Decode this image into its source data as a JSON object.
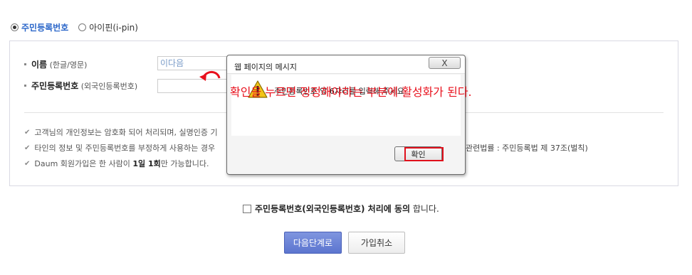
{
  "auth_options": {
    "resident_label": "주민등록번호",
    "ipin_label": "아이핀(i-pin)"
  },
  "form": {
    "name_label": "이름",
    "name_sub": "(한글/영문)",
    "name_value": "이다음",
    "id_label": "주민등록번호",
    "id_sub": "(외국인등록번호)",
    "id_value": ""
  },
  "notes": {
    "line1": "고객님의 개인정보는 암호화 되어 처리되며, 실명인증 기",
    "line2": "타인의 정보 및 주민등록번호를 부정하게 사용하는 경우",
    "line2_right": "관련법률 : 주민등록법 제 37조(벌칙)",
    "line3_pre": "Daum 회원가입은 한 사람이",
    "line3_bold": "1일 1회",
    "line3_post": "만 가능합니다."
  },
  "agreement": {
    "bold": "주민등록번호(외국인등록번호) 처리에 동의",
    "rest": "합니다."
  },
  "buttons": {
    "next": "다음단계로",
    "cancel": "가입취소"
  },
  "dialog": {
    "title": "웹 페이지의 메시지",
    "close": "X",
    "message": "주민등록번호 앞 6자리를 입력해 주세요.",
    "ok": "확인"
  },
  "annotation": "확인을 누르면 정정해야하는 부분에 활성화가 된다.",
  "colors": {
    "selected_radio": "#2a66c9",
    "annotation_red": "#e8101c",
    "next_button": "#6a82d6"
  }
}
